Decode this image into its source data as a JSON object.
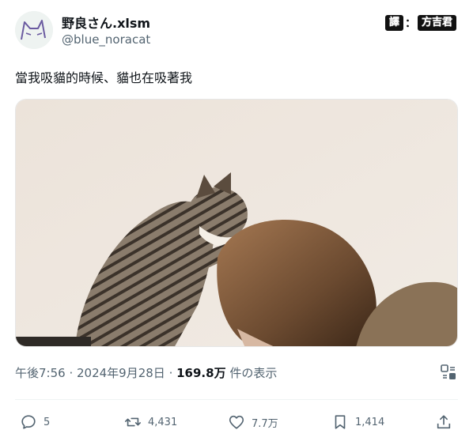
{
  "user": {
    "display_name": "野良さん.xlsm",
    "handle": "@blue_noracat"
  },
  "watermark": {
    "left": "譯",
    "sep": "：",
    "right": "方吉君"
  },
  "tweet": {
    "text": "當我吸貓的時候、貓也在吸著我"
  },
  "meta": {
    "time": "午後7:56",
    "sep1": " · ",
    "date": "2024年9月28日",
    "sep2": " · ",
    "views": "169.8万",
    "views_suffix": " 件の表示"
  },
  "actions": {
    "reply": "5",
    "retweet": "4,431",
    "like": "7.7万",
    "bookmark": "1,414"
  },
  "icons": {
    "reply": "reply-icon",
    "retweet": "retweet-icon",
    "like": "heart-icon",
    "bookmark": "bookmark-icon",
    "share": "share-icon",
    "translate": "translate-icon"
  },
  "colors": {
    "text": "#0f1419",
    "secondary": "#536471",
    "wall": "#efe7df"
  }
}
